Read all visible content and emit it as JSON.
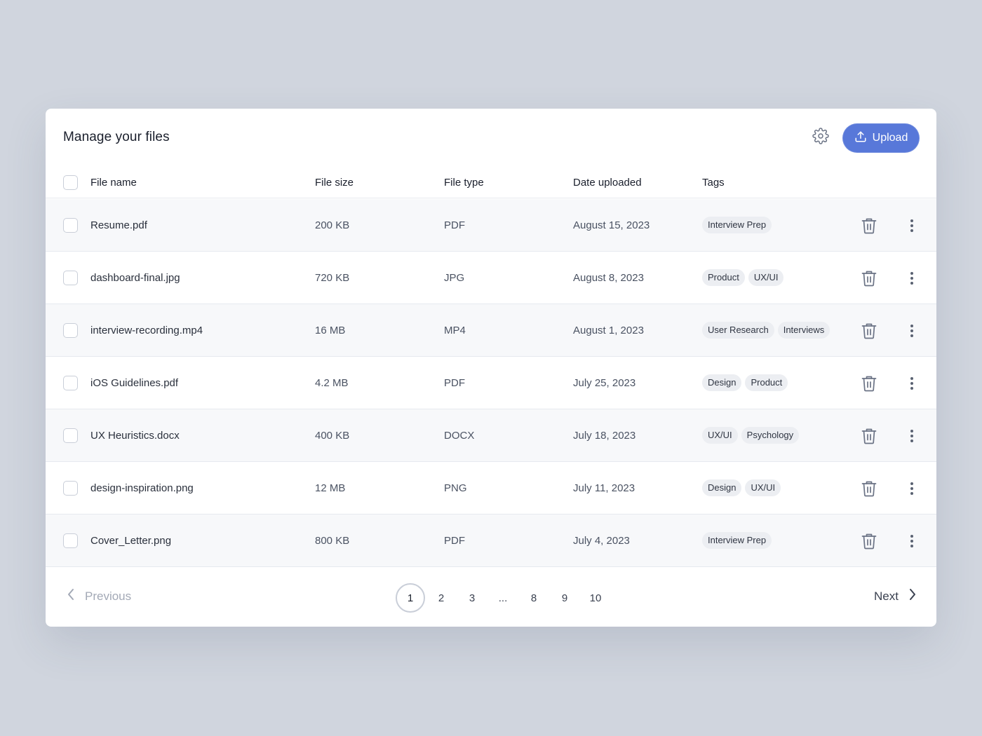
{
  "header": {
    "title": "Manage your files",
    "upload_label": "Upload"
  },
  "columns": {
    "file_name": "File name",
    "file_size": "File size",
    "file_type": "File type",
    "date_uploaded": "Date uploaded",
    "tags": "Tags"
  },
  "rows": [
    {
      "name": "Resume.pdf",
      "size": "200 KB",
      "type": "PDF",
      "date": "August 15, 2023",
      "tags": [
        "Interview Prep"
      ]
    },
    {
      "name": "dashboard-final.jpg",
      "size": "720 KB",
      "type": "JPG",
      "date": "August 8, 2023",
      "tags": [
        "Product",
        "UX/UI"
      ]
    },
    {
      "name": "interview-recording.mp4",
      "size": "16 MB",
      "type": "MP4",
      "date": "August 1, 2023",
      "tags": [
        "User Research",
        "Interviews"
      ]
    },
    {
      "name": "iOS Guidelines.pdf",
      "size": "4.2 MB",
      "type": "PDF",
      "date": "July 25, 2023",
      "tags": [
        "Design",
        "Product"
      ]
    },
    {
      "name": "UX Heuristics.docx",
      "size": "400 KB",
      "type": "DOCX",
      "date": "July 18, 2023",
      "tags": [
        "UX/UI",
        "Psychology"
      ]
    },
    {
      "name": "design-inspiration.png",
      "size": "12 MB",
      "type": "PNG",
      "date": "July 11, 2023",
      "tags": [
        "Design",
        "UX/UI"
      ]
    },
    {
      "name": "Cover_Letter.png",
      "size": "800 KB",
      "type": "PDF",
      "date": "July 4, 2023",
      "tags": [
        "Interview Prep"
      ]
    }
  ],
  "pagination": {
    "previous_label": "Previous",
    "next_label": "Next",
    "pages": [
      "1",
      "2",
      "3",
      "...",
      "8",
      "9",
      "10"
    ],
    "current": "1"
  },
  "icons": {
    "settings": "gear-icon",
    "upload": "upload-icon",
    "delete": "trash-icon",
    "more": "more-vertical-icon",
    "previous": "chevron-left-icon",
    "next": "chevron-right-icon"
  },
  "colors": {
    "background": "#d0d5de",
    "accent": "#5878d9",
    "row_alt": "#f7f8fa",
    "tag_bg": "#eceef2"
  }
}
